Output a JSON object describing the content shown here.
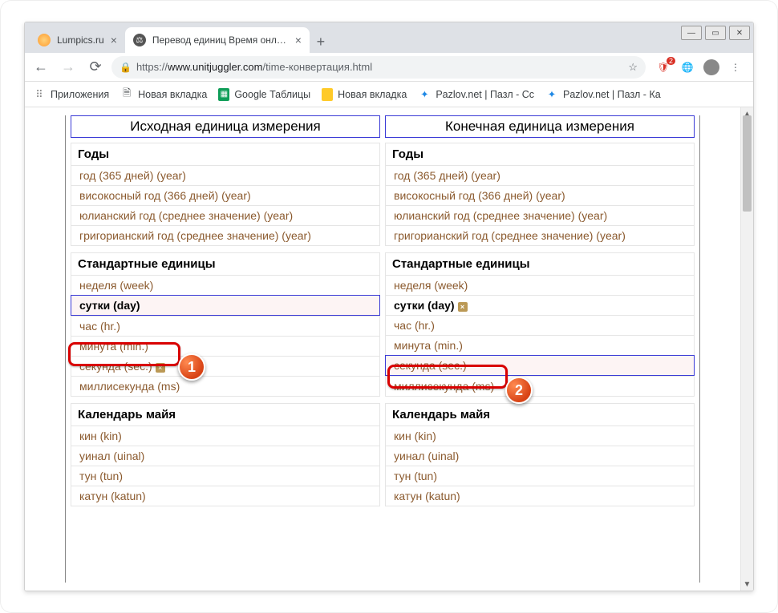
{
  "tabs": [
    {
      "title": "Lumpics.ru",
      "active": false
    },
    {
      "title": "Перевод единиц Время онлайн",
      "active": true
    }
  ],
  "url": {
    "host": "www.unitjuggler.com",
    "scheme": "https://",
    "path": "/time-конвертация.html"
  },
  "star": "☆",
  "bookmarks": {
    "apps": "Приложения",
    "items": [
      "Новая вкладка",
      "Google Таблицы",
      "Новая вкладка",
      "Pazlov.net | Пазл - Сс",
      "Pazlov.net | Пазл - Ка"
    ]
  },
  "headers": {
    "source": "Исходная единица измерения",
    "target": "Конечная единица измерения"
  },
  "groups": {
    "years": "Годы",
    "standard": "Стандартные единицы",
    "maya": "Календарь майя"
  },
  "years_units": [
    "год (365 дней) (year)",
    "високосный год (366 дней) (year)",
    "юлианский год (среднее значение) (year)",
    "григорианский год (среднее значение) (year)"
  ],
  "standard_units": {
    "week": "неделя (week)",
    "day": "сутки (day)",
    "hour": "час (hr.)",
    "minute": "минута (min.)",
    "second": "секунда (sec.)",
    "ms": "миллисекунда (ms)"
  },
  "maya_units": [
    "кин (kin)",
    "уинал (uinal)",
    "тун (tun)",
    "катун (katun)"
  ],
  "callouts": {
    "n1": "1",
    "n2": "2"
  }
}
